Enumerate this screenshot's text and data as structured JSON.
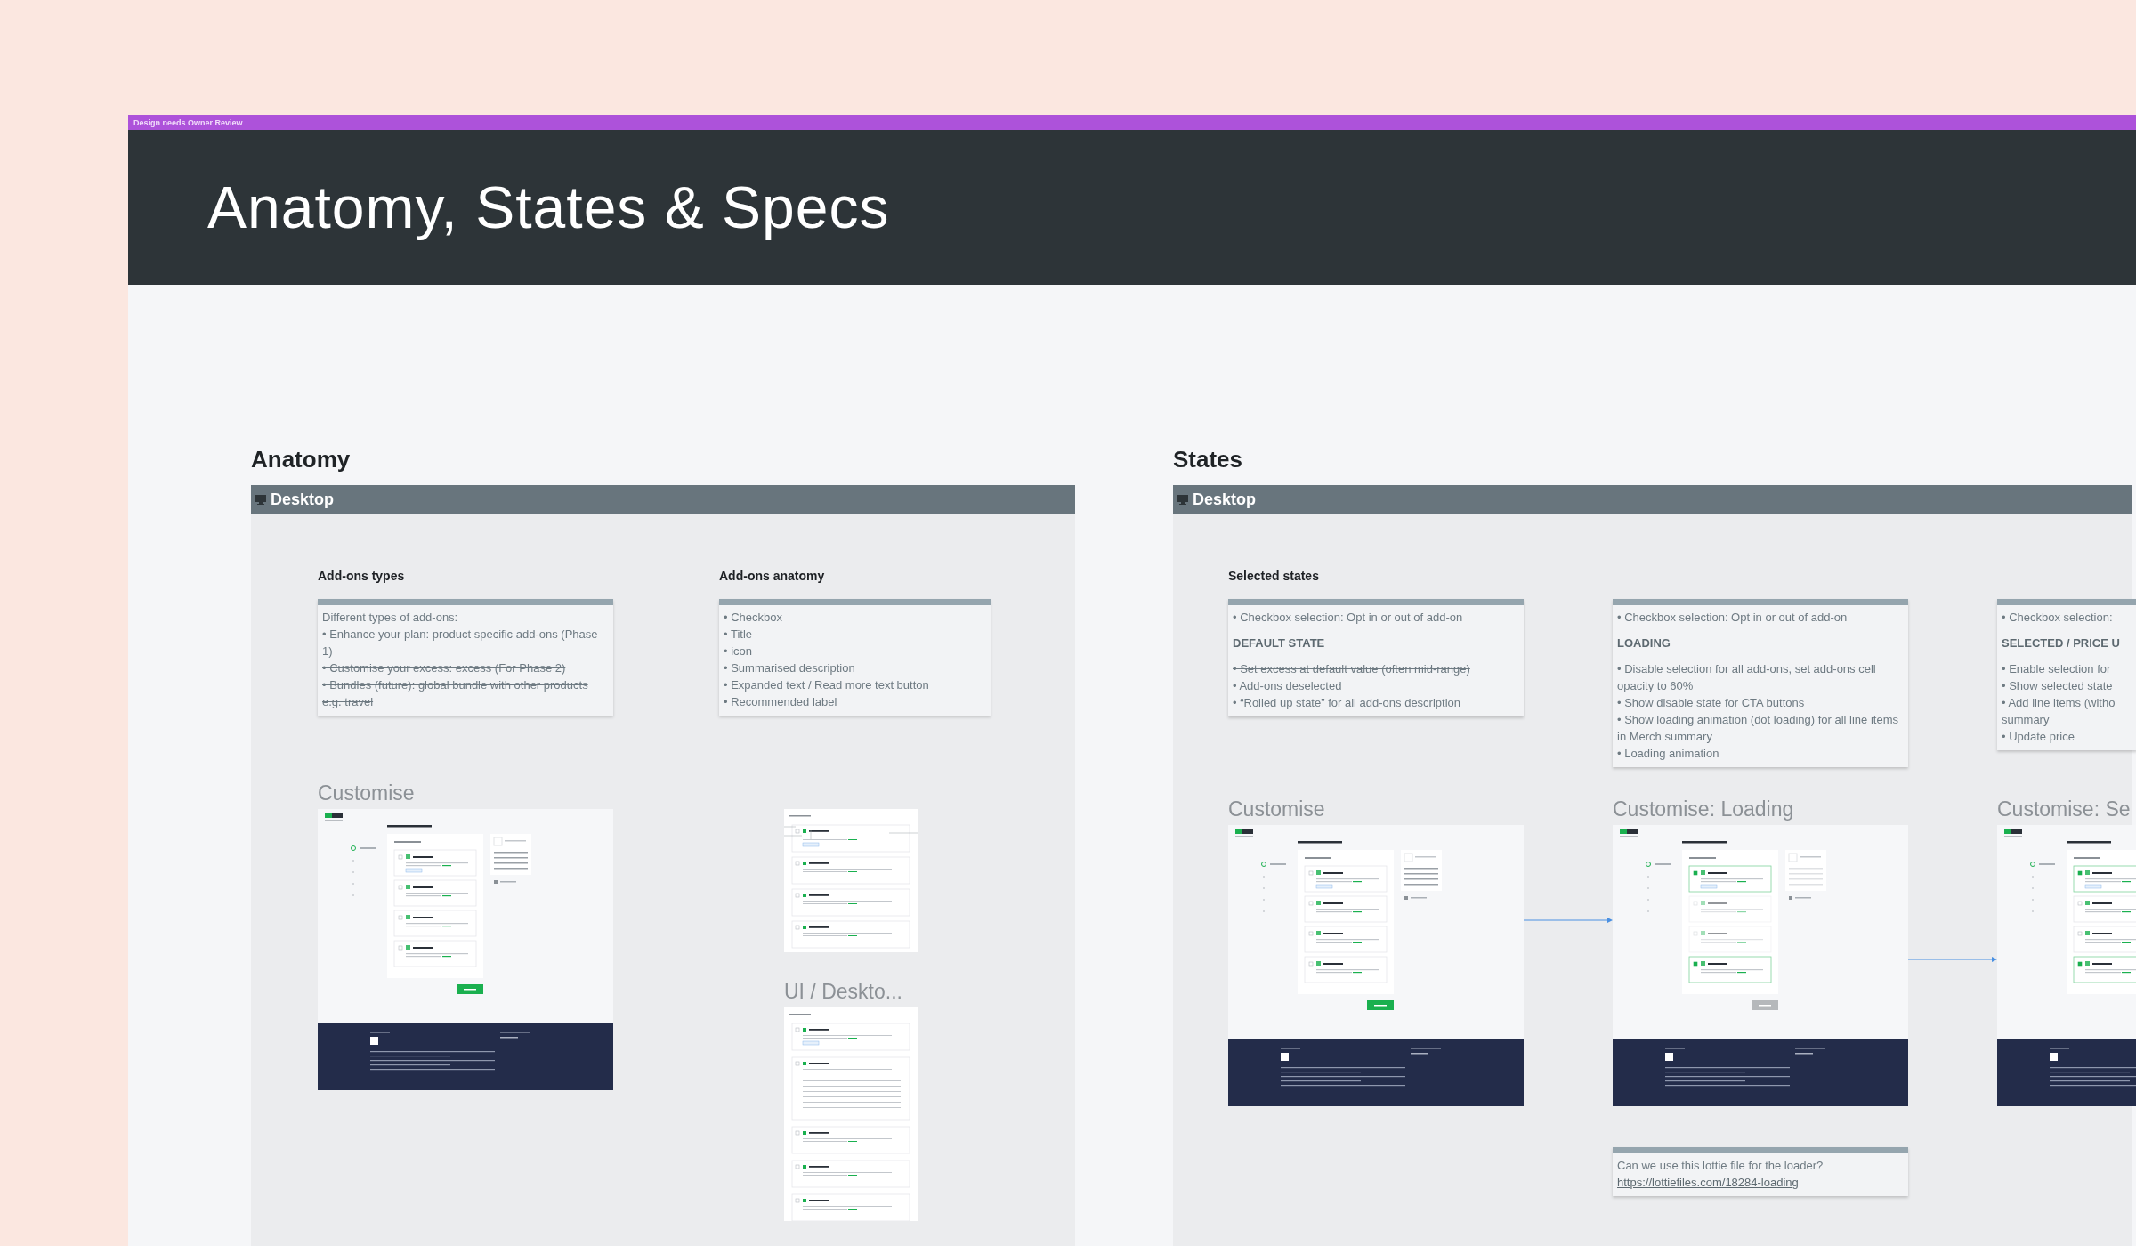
{
  "banner": {
    "label": "Design needs Owner Review"
  },
  "title": "Anatomy, States & Specs",
  "anatomy": {
    "heading": "Anatomy",
    "frame_title": "Desktop",
    "columns": [
      {
        "title": "Add-ons types",
        "note": [
          {
            "text": "Different types of add-ons:",
            "kind": "text",
            "struck": false
          },
          {
            "text": "• Enhance your plan: product specific add-ons (Phase 1)",
            "kind": "text",
            "struck": false
          },
          {
            "text": "• Customise your excess: excess (For Phase 2)",
            "kind": "text",
            "struck": true
          },
          {
            "text": "• Bundles (future): global bundle with other products e.g. travel",
            "kind": "text",
            "struck": true
          }
        ],
        "screens": [
          {
            "label": "Customise",
            "kind": "default"
          }
        ]
      },
      {
        "title": "Add-ons anatomy",
        "note": [
          {
            "text": "• Checkbox",
            "kind": "text",
            "struck": false
          },
          {
            "text": "• Title",
            "kind": "text",
            "struck": false
          },
          {
            "text": "• icon",
            "kind": "text",
            "struck": false
          },
          {
            "text": "• Summarised description",
            "kind": "text",
            "struck": false
          },
          {
            "text": "• Expanded text / Read more text button",
            "kind": "text",
            "struck": false
          },
          {
            "text": "• Recommended label",
            "kind": "text",
            "struck": false
          }
        ],
        "screens": [
          {
            "kind": "annotated"
          },
          {
            "label": "UI / Deskto...",
            "kind": "expanded"
          }
        ]
      }
    ]
  },
  "states": {
    "heading": "States",
    "frame_title": "Desktop",
    "title": "Selected states",
    "columns": [
      {
        "note": [
          {
            "text": "• Checkbox selection: Opt in or out of add-on",
            "kind": "text",
            "struck": false
          },
          {
            "text": "DEFAULT STATE",
            "kind": "heading",
            "struck": false
          },
          {
            "text": "• Set excess at default value (often mid-range)",
            "kind": "text",
            "struck": true
          },
          {
            "text": "• Add-ons deselected",
            "kind": "text",
            "struck": false
          },
          {
            "text": "• “Rolled up state” for all add-ons description",
            "kind": "text",
            "struck": false
          }
        ],
        "screen": {
          "label": "Customise",
          "kind": "default"
        }
      },
      {
        "note": [
          {
            "text": "• Checkbox selection: Opt in or out of add-on",
            "kind": "text",
            "struck": false
          },
          {
            "text": "LOADING",
            "kind": "heading",
            "struck": false
          },
          {
            "text": "• Disable selection for all add-ons, set add-ons cell opacity to 60%",
            "kind": "text",
            "struck": false
          },
          {
            "text": "• Show disable state for CTA buttons",
            "kind": "text",
            "struck": false
          },
          {
            "text": "• Show loading animation (dot loading) for all line items in Merch summary",
            "kind": "text",
            "struck": false
          },
          {
            "text": "• Loading animation",
            "kind": "text",
            "struck": false
          }
        ],
        "screen": {
          "label": "Customise: Loading",
          "kind": "loading"
        },
        "comment": {
          "text": "Can we use this lottie file for the loader?",
          "link": "https://lottiefiles.com/18284-loading"
        }
      },
      {
        "note": [
          {
            "text": "• Checkbox selection:",
            "kind": "text",
            "struck": false
          },
          {
            "text": "SELECTED / PRICE U",
            "kind": "heading",
            "struck": false
          },
          {
            "text": "• Enable selection for",
            "kind": "text",
            "struck": false
          },
          {
            "text": "• Show selected state",
            "kind": "text",
            "struck": false
          },
          {
            "text": "• Add line items (witho\nsummary",
            "kind": "text",
            "struck": false
          },
          {
            "text": "• Update price",
            "kind": "text",
            "struck": false
          }
        ],
        "screen": {
          "label": "Customise: Se",
          "kind": "selected"
        }
      }
    ]
  }
}
